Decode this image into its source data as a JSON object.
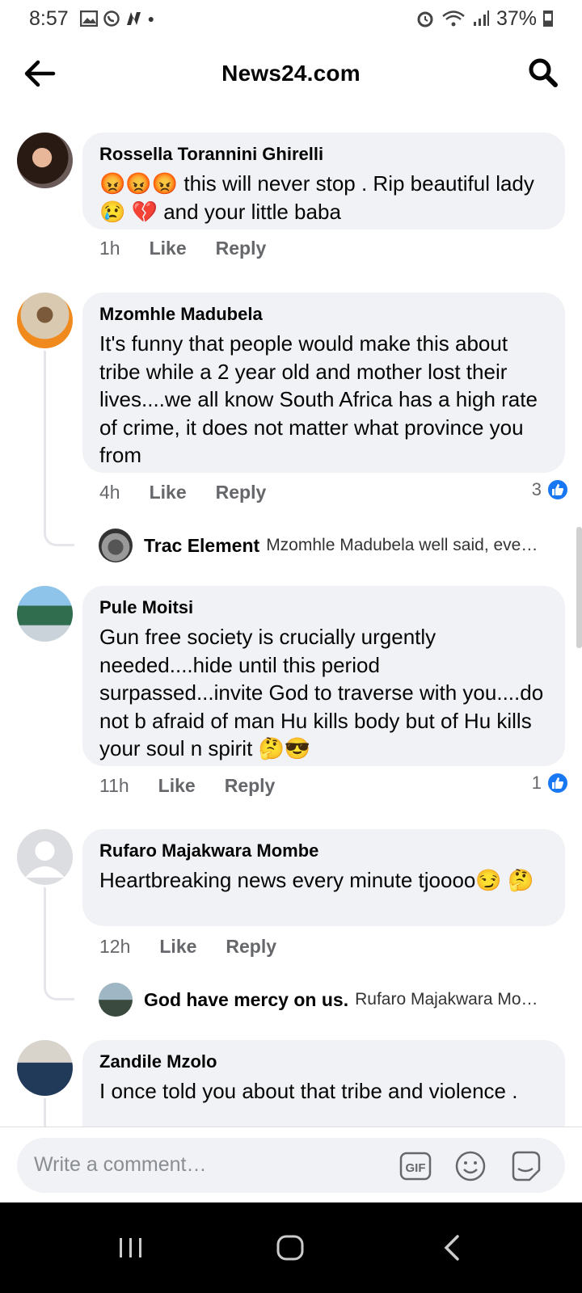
{
  "status_bar": {
    "time": "8:57",
    "battery": "37%"
  },
  "header": {
    "title": "News24.com"
  },
  "comments": [
    {
      "author": "Rossella Torannini Ghirelli",
      "text_html_parts": [
        "😡😡😡 this will never stop . Rip beautiful lady 😢 💔  and your little baba"
      ],
      "time": "1h",
      "like_label": "Like",
      "reply_label": "Reply"
    },
    {
      "author": "Mzomhle Madubela",
      "text": "It's funny that people would make this about tribe while a 2 year old and mother  lost their lives....we all know South Africa has a high rate of crime, it does not matter what province you from",
      "time": "4h",
      "like_label": "Like",
      "reply_label": "Reply",
      "like_count": "3",
      "reply": {
        "name": "Trac Element",
        "text": "Mzomhle Madubela well said, eve…"
      }
    },
    {
      "author": "Pule Moitsi",
      "text": "Gun free society is crucially urgently needed....hide until this period surpassed...invite God to traverse with you....do not b afraid of man Hu kills body but of Hu kills your soul n spirit 🤔😎",
      "time": "11h",
      "like_label": "Like",
      "reply_label": "Reply",
      "like_count": "1"
    },
    {
      "author": "Rufaro Majakwara Mombe",
      "text": "Heartbreaking news every minute tjoooo😏 🤔",
      "time": "12h",
      "like_label": "Like",
      "reply_label": "Reply",
      "reply": {
        "name": "God have mercy on us.",
        "text": "Rufaro Majakwara Mo…"
      }
    },
    {
      "author": "Zandile Mzolo",
      "text": "I once told you about that tribe and violence ."
    }
  ],
  "composer": {
    "placeholder": "Write a comment…"
  },
  "colors": {
    "accent": "#1877f2",
    "bubble": "#f0f2f5",
    "meta": "#65676b"
  },
  "icons": [
    "back-arrow-icon",
    "search-icon",
    "gif-icon",
    "emoji-icon",
    "sticker-icon",
    "like-thumb-icon"
  ]
}
